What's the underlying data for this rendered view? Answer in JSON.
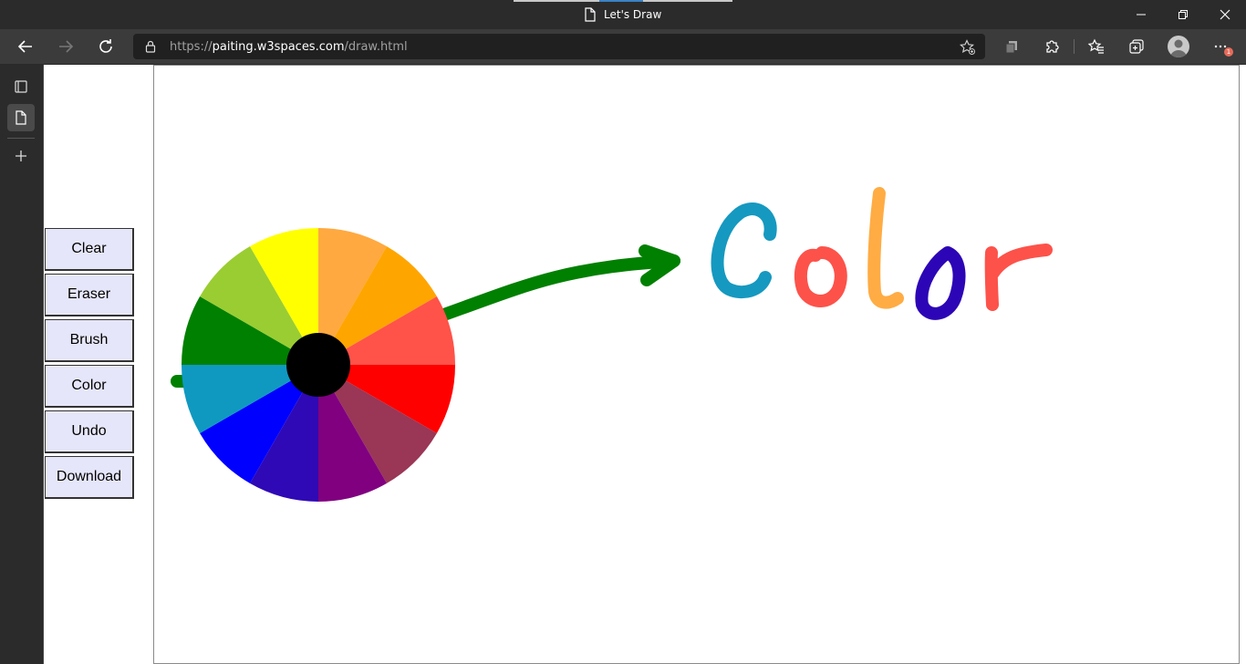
{
  "window": {
    "title": "Let's Draw"
  },
  "address_bar": {
    "scheme": "https://",
    "host": "paiting.w3spaces.com",
    "path": "/draw.html"
  },
  "extension_badge": "1",
  "sidebar": {
    "buttons": [
      {
        "label": "Clear"
      },
      {
        "label": "Eraser"
      },
      {
        "label": "Brush"
      },
      {
        "label": "Color"
      },
      {
        "label": "Undo"
      },
      {
        "label": "Download"
      }
    ]
  },
  "drawing": {
    "handwritten_text": "Color",
    "letter_colors": [
      "#1599c0",
      "#fd524a",
      "#ffac44",
      "#2c05b6",
      "#fd524a"
    ],
    "arrow_color": "#008000",
    "color_wheel": {
      "center_color": "#000000",
      "segments": [
        "#ffa940",
        "#ffa500",
        "#ff5249",
        "#ff0000",
        "#9a3656",
        "#800080",
        "#2f09b5",
        "#0000ff",
        "#0f99c1",
        "#008000",
        "#9acd32",
        "#ffff00"
      ]
    }
  }
}
